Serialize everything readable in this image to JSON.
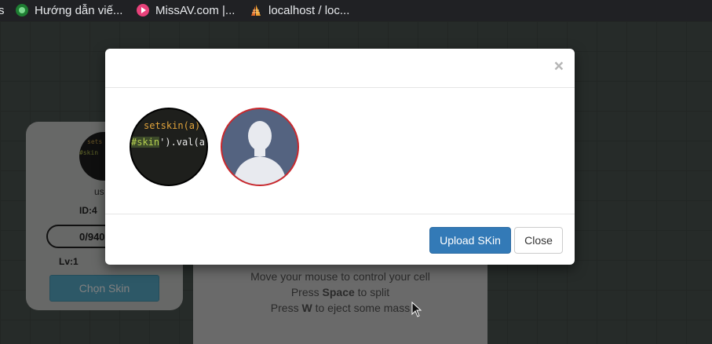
{
  "bookmarks": [
    {
      "label": "s",
      "icon": "truncated-icon"
    },
    {
      "label": "Hướng dẫn viế...",
      "icon": "leaf-icon"
    },
    {
      "label": "MissAV.com |...",
      "icon": "play-icon"
    },
    {
      "label": "localhost / loc...",
      "icon": "phpmyadmin-sail-icon"
    }
  ],
  "player_card": {
    "avatar_line1": "sets",
    "avatar_line2": "#skin",
    "name": "us",
    "id": "ID:4",
    "progress": "0/940",
    "level": "Lv:1",
    "choose_skin_button": "Chọn Skin"
  },
  "instructions": {
    "line1": "Move your mouse to control your cell",
    "line2_prefix": "Press ",
    "line2_key": "Space",
    "line2_suffix": " to split",
    "line3_prefix": "Press ",
    "line3_key": "W",
    "line3_suffix": " to eject some mass"
  },
  "modal": {
    "close_symbol": "×",
    "skins": [
      {
        "name": "code-skin",
        "line1": "setskin(a)",
        "line2_hl": "#skin",
        "line2_rest": "').val(a"
      },
      {
        "name": "default-avatar-skin"
      }
    ],
    "upload_button": "Upload SKin",
    "close_button": "Close"
  },
  "colors": {
    "primary": "#337ab7",
    "selected_border": "#c9282d",
    "choose_skin_button": "#5bb0ce"
  }
}
